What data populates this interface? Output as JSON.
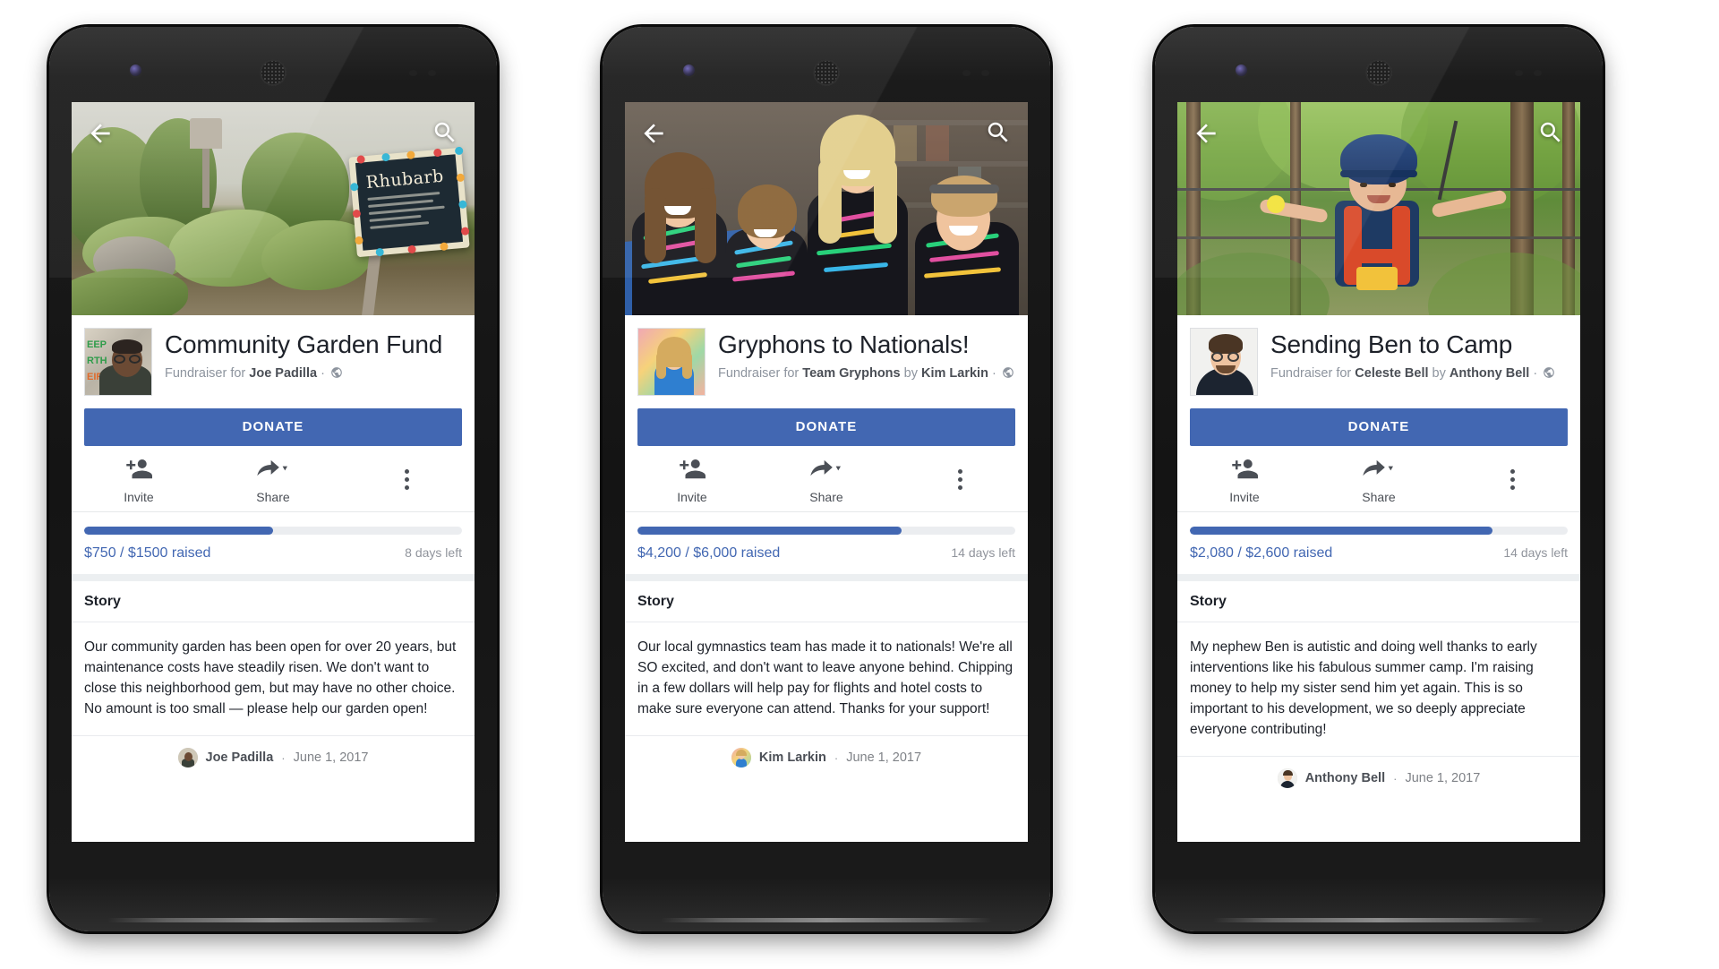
{
  "page": {
    "background": "#ffffff"
  },
  "accent": {
    "brand_blue": "#4267b2",
    "progress_track": "#ebedf0",
    "muted_text": "#90949c"
  },
  "nav": {
    "back_icon": "arrow-left-icon",
    "search_icon": "search-icon"
  },
  "common": {
    "donate_label": "DONATE",
    "invite_label": "Invite",
    "share_label": "Share",
    "more_label": "more-options",
    "story_heading": "Story",
    "byline_separator": "·",
    "privacy_icon": "globe-icon"
  },
  "phones": [
    {
      "id": "phone-1",
      "cover_image": "community-garden-photo",
      "avatar_image": "joe-padilla-avatar",
      "title": "Community Garden Fund",
      "subtitle_prefix": "Fundraiser for",
      "beneficiary": "Joe Padilla",
      "organizer_prefix": "",
      "organizer": "",
      "progress_percent": 50,
      "raised": "$750 / $1500 raised",
      "days_left": "8 days left",
      "story": "Our community garden has been open for over 20 years, but maintenance costs have steadily risen. We don't want to close this neighborhood gem, but may have no other choice. No amount is too small — please help our garden open!",
      "author": "Joe Padilla",
      "date": "June 1, 2017"
    },
    {
      "id": "phone-2",
      "cover_image": "gymnastics-team-photo",
      "avatar_image": "kim-larkin-avatar",
      "title": "Gryphons to Nationals!",
      "subtitle_prefix": "Fundraiser for",
      "beneficiary": "Team Gryphons",
      "organizer_prefix": "by",
      "organizer": "Kim Larkin",
      "progress_percent": 70,
      "raised": "$4,200 / $6,000 raised",
      "days_left": "14 days left",
      "story": "Our local gymnastics team has made it to nationals! We're all SO excited, and don't want to leave anyone behind. Chipping in a few dollars will help pay for flights and hotel costs to make sure everyone can attend. Thanks for your support!",
      "author": "Kim Larkin",
      "date": "June 1, 2017"
    },
    {
      "id": "phone-3",
      "cover_image": "boy-ropes-course-photo",
      "avatar_image": "anthony-bell-avatar",
      "title": "Sending Ben to Camp",
      "subtitle_prefix": "Fundraiser for",
      "beneficiary": "Celeste Bell",
      "organizer_prefix": "by",
      "organizer": "Anthony Bell",
      "progress_percent": 80,
      "raised": "$2,080 / $2,600 raised",
      "days_left": "14 days left",
      "story": "My nephew Ben is autistic and doing well thanks to early interventions like his fabulous summer camp. I'm raising money to help my sister send him yet again. This is so important to his development, we so deeply appreciate everyone contributing!",
      "author": "Anthony Bell",
      "date": "June 1, 2017"
    }
  ]
}
